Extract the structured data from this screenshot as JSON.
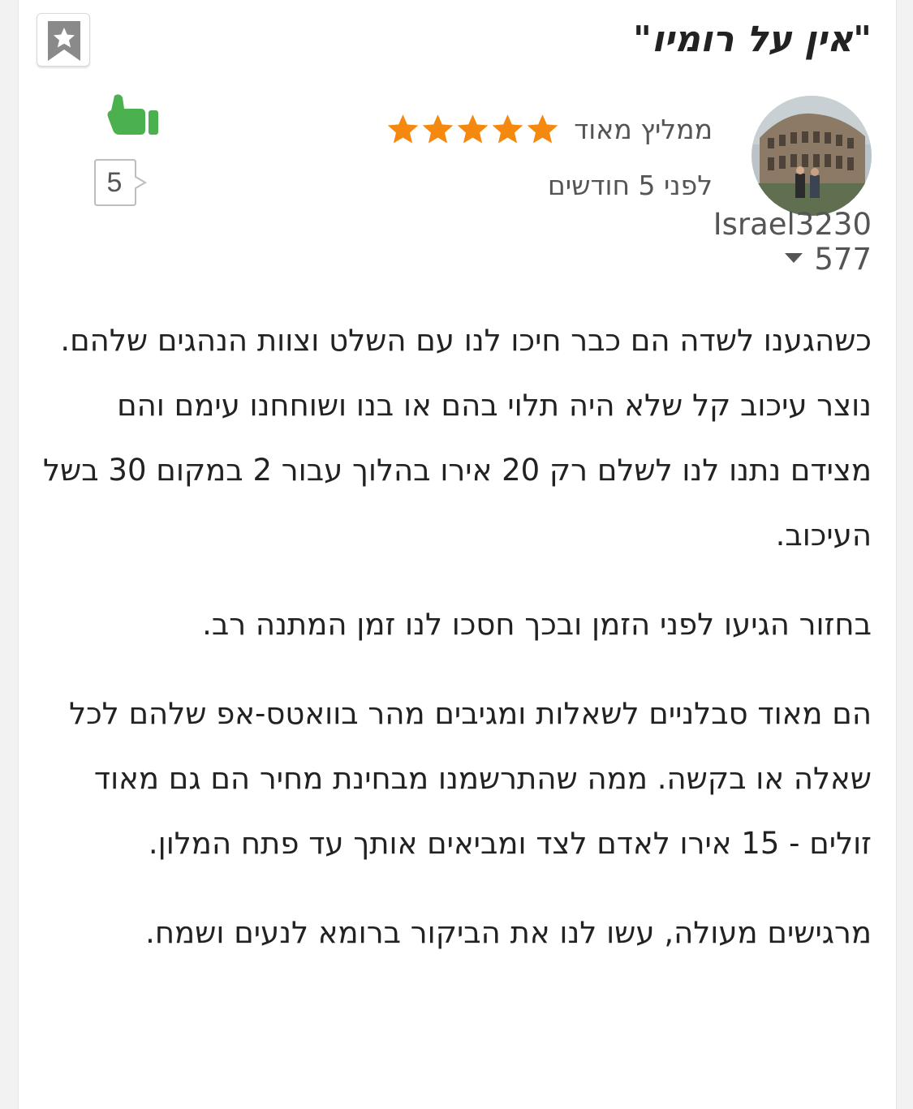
{
  "review": {
    "title": "\"אין על רומיו\"",
    "username": "Israel3230",
    "contributions": "577",
    "rating_label": "ממליץ מאוד",
    "stars": 5,
    "date": "לפני 5 חודשים",
    "helpful_count": "5",
    "paragraphs": [
      "כשהגענו לשדה הם כבר חיכו לנו עם השלט וצוות הנהגים שלהם. נוצר עיכוב קל שלא היה תלוי בהם או בנו ושוחחנו עימם והם מצידם נתנו לנו לשלם רק 20 אירו בהלוך עבור 2 במקום 30 בשל העיכוב.",
      "בחזור הגיעו לפני הזמן ובכך חסכו לנו זמן המתנה רב.",
      "הם מאוד סבלניים לשאלות ומגיבים מהר בוואטס-אפ שלהם לכל שאלה או בקשה. ממה שהתרשמנו מבחינת מחיר הם גם מאוד זולים - 15 אירו לאדם לצד ומביאים אותך עד פתח המלון.",
      "מרגישים מעולה, עשו לנו את הביקור ברומא לנעים ושמח."
    ]
  },
  "colors": {
    "star": "#f5890f",
    "thumb": "#4bb04e",
    "text": "#222222",
    "muted": "#555555"
  },
  "icons": {
    "bookmark": "bookmark-star-icon",
    "thumb": "thumbs-up-icon",
    "helpful_bubble": "speech-bubble-icon",
    "caret": "caret-down-icon",
    "star": "star-icon"
  }
}
